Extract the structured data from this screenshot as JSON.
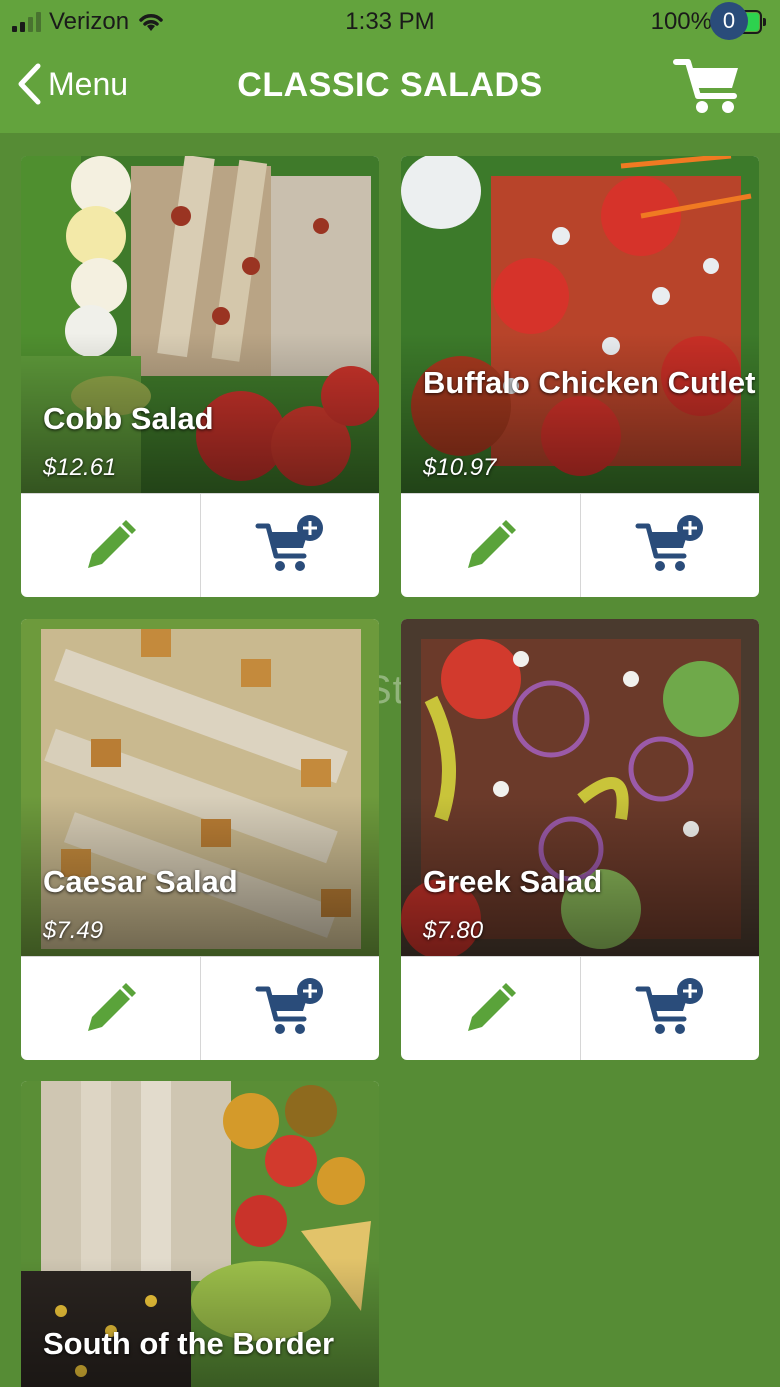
{
  "status_bar": {
    "carrier": "Verizon",
    "time": "1:33 PM",
    "battery": "100%"
  },
  "nav": {
    "back_label": "Menu",
    "title": "CLASSIC SALADS",
    "cart_count": "0"
  },
  "colors": {
    "header_green": "#63a33d",
    "page_green": "#568c35",
    "edit_icon": "#5aa33a",
    "cart_icon": "#2a4c7a"
  },
  "items": [
    {
      "name": "Cobb Salad",
      "price": "$12.61",
      "edit_icon": "pencil-icon",
      "add_icon": "cart-plus-icon"
    },
    {
      "name": "Buffalo Chicken Cutlet",
      "price": "$10.97",
      "edit_icon": "pencil-icon",
      "add_icon": "cart-plus-icon"
    },
    {
      "name": "Caesar Salad",
      "price": "$7.49",
      "edit_icon": "pencil-icon",
      "add_icon": "cart-plus-icon"
    },
    {
      "name": "Greek Salad",
      "price": "$7.80",
      "edit_icon": "pencil-icon",
      "add_icon": "cart-plus-icon"
    },
    {
      "name": "South of the Border",
      "price": "",
      "edit_icon": "pencil-icon",
      "add_icon": "cart-plus-icon"
    }
  ],
  "watermark": "UpdateStar.com"
}
